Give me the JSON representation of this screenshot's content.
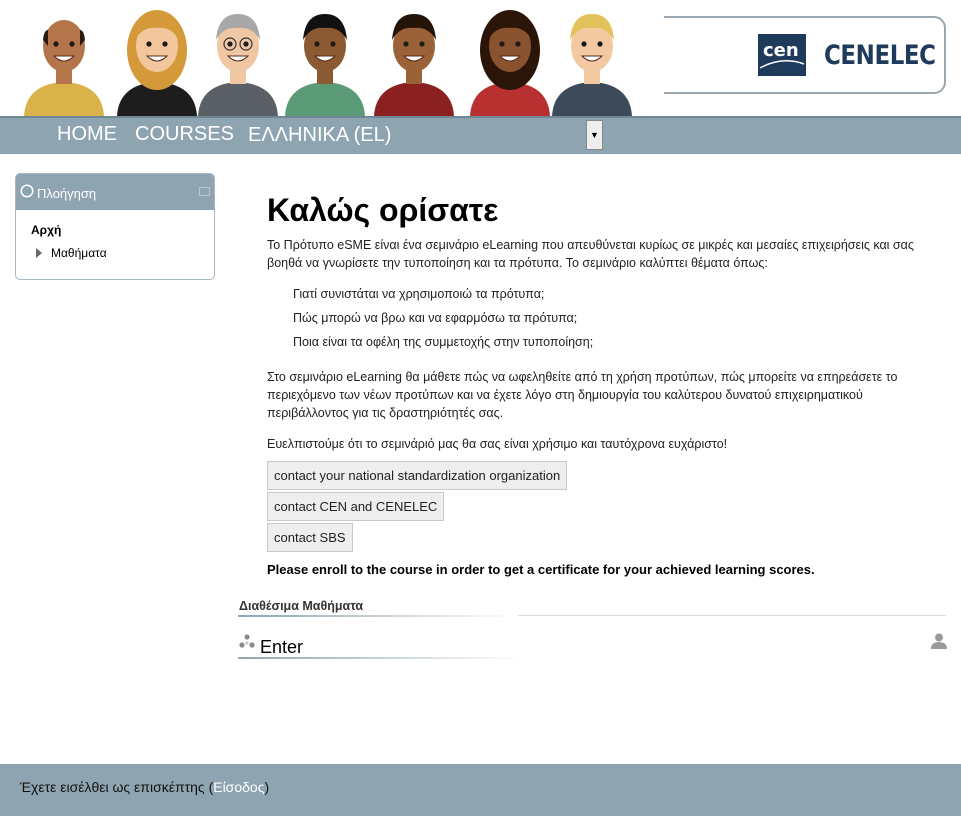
{
  "header": {
    "logo_text": "CENELEC",
    "logo_mark": "cen",
    "avatars": [
      "avatar-1",
      "avatar-2",
      "avatar-3",
      "avatar-4",
      "avatar-5",
      "avatar-6",
      "avatar-7"
    ]
  },
  "nav": {
    "home": "HOME",
    "courses": "COURSES",
    "language": "ΕΛΛΗΝΙΚΑ (EL)"
  },
  "block": {
    "title": "Πλοήγηση",
    "home": "Αρχή",
    "courses": "Μαθήματα"
  },
  "main": {
    "title": "Καλώς ορίσατε",
    "intro": "Το Πρότυπο eSME είναι ένα σεμινάριο eLearning που απευθύνεται κυρίως σε μικρές και μεσαίες επιχειρήσεις και σας βοηθά να γνωρίσετε την τυποποίηση και τα πρότυπα. Το σεμινάριο καλύπτει θέματα όπως:",
    "bullets": [
      "Γιατί συνιστάται να χρησιμοποιώ τα πρότυπα;",
      "Πώς μπορώ να βρω και να εφαρμόσω τα πρότυπα;",
      "Ποια είναι τα οφέλη της συμμετοχής στην τυποποίηση;"
    ],
    "para2": "Στο σεμινάριο eLearning θα μάθετε πώς να ωφεληθείτε από τη χρήση προτύπων, πώς μπορείτε να επηρεάσετε το περιεχόμενο των νέων προτύπων και να έχετε λόγο στη δημιουργία του καλύτερου δυνατού επιχειρηματικού περιβάλλοντος για τις δραστηριότητές σας.",
    "para3": "Ευελπιστούμε ότι το σεμινάριό μας θα σας είναι χρήσιμο και ταυτόχρονα ευχάριστο!",
    "buttons": [
      "contact your national standardization organization",
      "contact CEN and CENELEC",
      "contact SBS"
    ],
    "enroll": "Please enroll to the course in order to get a certificate for your achieved learning scores."
  },
  "available": {
    "heading": "Διαθέσιμα Μαθήματα",
    "course_name": "Enter"
  },
  "footer": {
    "text_before": "Έχετε εισέλθει ως επισκέπτης (",
    "login": "Είσοδος",
    "text_after": ")"
  },
  "colors": {
    "bar": "#8fa4b1",
    "logo_blue": "#1f3b5c"
  },
  "icons": [
    "compass-icon",
    "minimize-icon",
    "chevron-down-icon",
    "collapsed-arrow-icon",
    "course-icon",
    "guest-user-icon"
  ]
}
